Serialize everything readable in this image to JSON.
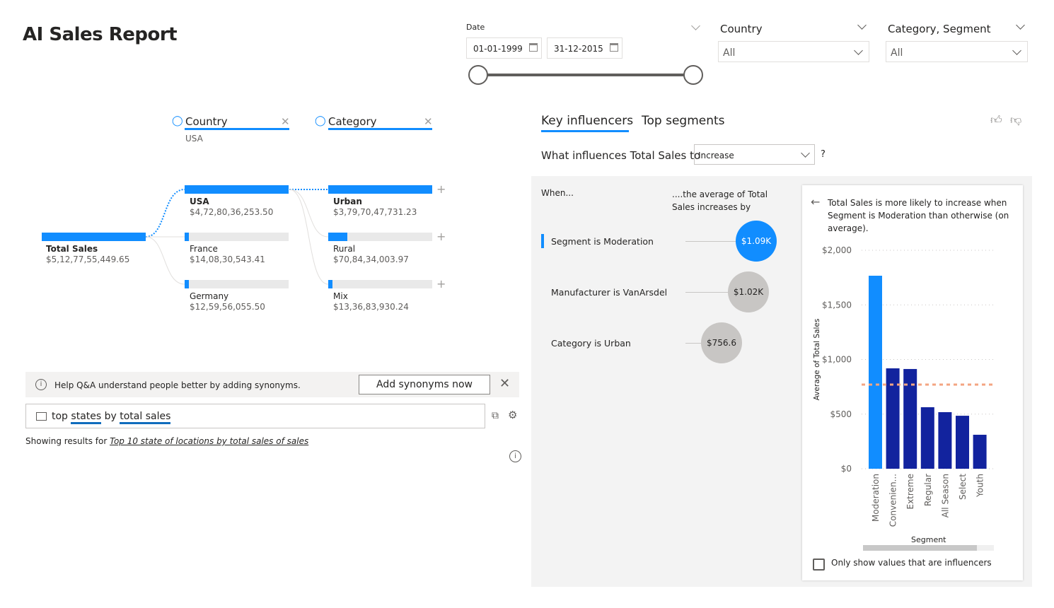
{
  "title": "AI Sales Report",
  "filters": {
    "date": {
      "label": "Date",
      "start": "01-01-1999",
      "end": "31-12-2015",
      "range_fraction": [
        0,
        1
      ]
    },
    "country": {
      "label": "Country",
      "value": "All"
    },
    "category_segment": {
      "label": "Category, Segment",
      "value": "All"
    }
  },
  "decomp_tree": {
    "levels": [
      {
        "label": "Country",
        "selected": "USA"
      },
      {
        "label": "Category"
      }
    ],
    "root": {
      "name": "Total Sales",
      "value": "$5,12,77,55,449.65"
    },
    "country_nodes": [
      {
        "name": "USA",
        "value": "$4,72,80,36,253.50",
        "selected": true
      },
      {
        "name": "France",
        "value": "$14,08,30,543.41"
      },
      {
        "name": "Germany",
        "value": "$12,59,56,055.50"
      }
    ],
    "category_nodes": [
      {
        "name": "Urban",
        "value": "$3,79,70,47,731.23",
        "selected": true
      },
      {
        "name": "Rural",
        "value": "$70,84,34,003.97"
      },
      {
        "name": "Mix",
        "value": "$13,36,83,930.24"
      }
    ]
  },
  "qna": {
    "banner": "Help Q&A understand people better by adding synonyms.",
    "banner_button": "Add synonyms now",
    "query_words": [
      "top",
      "states",
      "by",
      "total sales"
    ],
    "showing_prefix": "Showing results for",
    "showing_link": "Top 10 state of locations by total sales of sales"
  },
  "key_influencers": {
    "tabs": [
      "Key influencers",
      "Top segments"
    ],
    "active_tab": 0,
    "question": "What influences Total Sales to",
    "question_value": "Increase",
    "help": "?",
    "col_when": "When...",
    "col_effect": "....the average of Total Sales increases by",
    "items": [
      {
        "label": "Segment is Moderation",
        "value": "$1.09K",
        "selected": true
      },
      {
        "label": "Manufacturer is VanArsdel",
        "value": "$1.02K"
      },
      {
        "label": "Category is Urban",
        "value": "$756.6"
      }
    ],
    "detail_text": "Total Sales is more likely to increase when Segment is Moderation than otherwise (on average).",
    "checkbox_label": "Only show values that are influencers",
    "checkbox_checked": false,
    "colors": {
      "accent": "#118dff",
      "bar": "#12239e",
      "avg_line": "#f4a582",
      "bubble_gray": "#c8c6c4"
    }
  },
  "chart_data": {
    "type": "bar",
    "categories": [
      "Moderation",
      "Convenien...",
      "Extreme",
      "Regular",
      "All Season",
      "Select",
      "Youth"
    ],
    "values": [
      1767,
      919,
      913,
      563,
      518,
      485,
      311
    ],
    "highlight": "Moderation",
    "reference_line": 770,
    "xlabel": "Segment",
    "ylabel": "Average of Total Sales",
    "ylim": [
      0,
      2000
    ],
    "yticks": [
      "$0",
      "$500",
      "$1,000",
      "$1,500",
      "$2,000"
    ],
    "ytick_values": [
      0,
      500,
      1000,
      1500,
      2000
    ],
    "grid": true
  }
}
